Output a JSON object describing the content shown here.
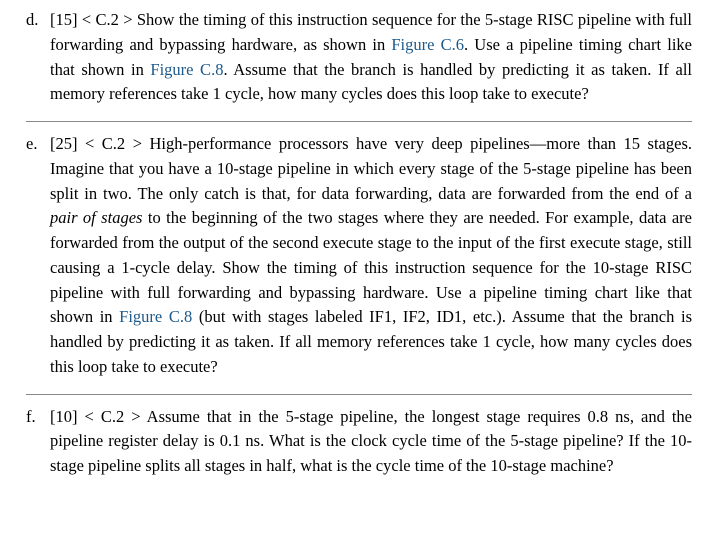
{
  "items": [
    {
      "marker": "d.",
      "prefix": "[15] < C.2 > ",
      "seg1": "Show the timing of this instruction sequence for the 5-stage RISC pipeline with full forwarding and bypassing hardware, as shown in ",
      "link1": "Figure C.6",
      "seg2": ". Use a pipeline timing chart like that shown in ",
      "link2": "Figure C.8",
      "seg3": ". Assume that the branch is handled by predicting it as taken. If all memory references take 1 cycle, how many cycles does this loop take to execute?"
    },
    {
      "marker": "e.",
      "prefix": "[25] < C.2 > ",
      "seg1": "High-performance processors have very deep pipelines—more than 15 stages. Imagine that you have a 10-stage pipeline in which every stage of the 5-stage pipeline has been split in two. The only catch is that, for data forwarding, data are forwarded from the end of a ",
      "italic1": "pair of stages",
      "seg2": " to the beginning of the two stages where they are needed. For example, data are forwarded from the output of the second execute stage to the input of the first execute stage, still causing a 1-cycle delay. Show the timing of this instruction sequence for the 10-stage RISC pipeline with full forwarding and bypassing hardware. Use a pipeline timing chart like that shown in ",
      "link1": "Figure C.8",
      "seg3": " (but with stages labeled IF1, IF2, ID1, etc.). Assume that the branch is handled by predicting it as taken. If all memory references take 1 cycle, how many cycles does this loop take to execute?"
    },
    {
      "marker": "f.",
      "prefix": "[10] < C.2 > ",
      "seg1": "Assume that in the 5-stage pipeline, the longest stage requires 0.8 ns, and the pipeline register delay is 0.1 ns. What is the clock cycle time of the 5-stage pipeline? If the 10-stage pipeline splits all stages in half, what is the cycle time of the 10-stage machine?"
    }
  ]
}
